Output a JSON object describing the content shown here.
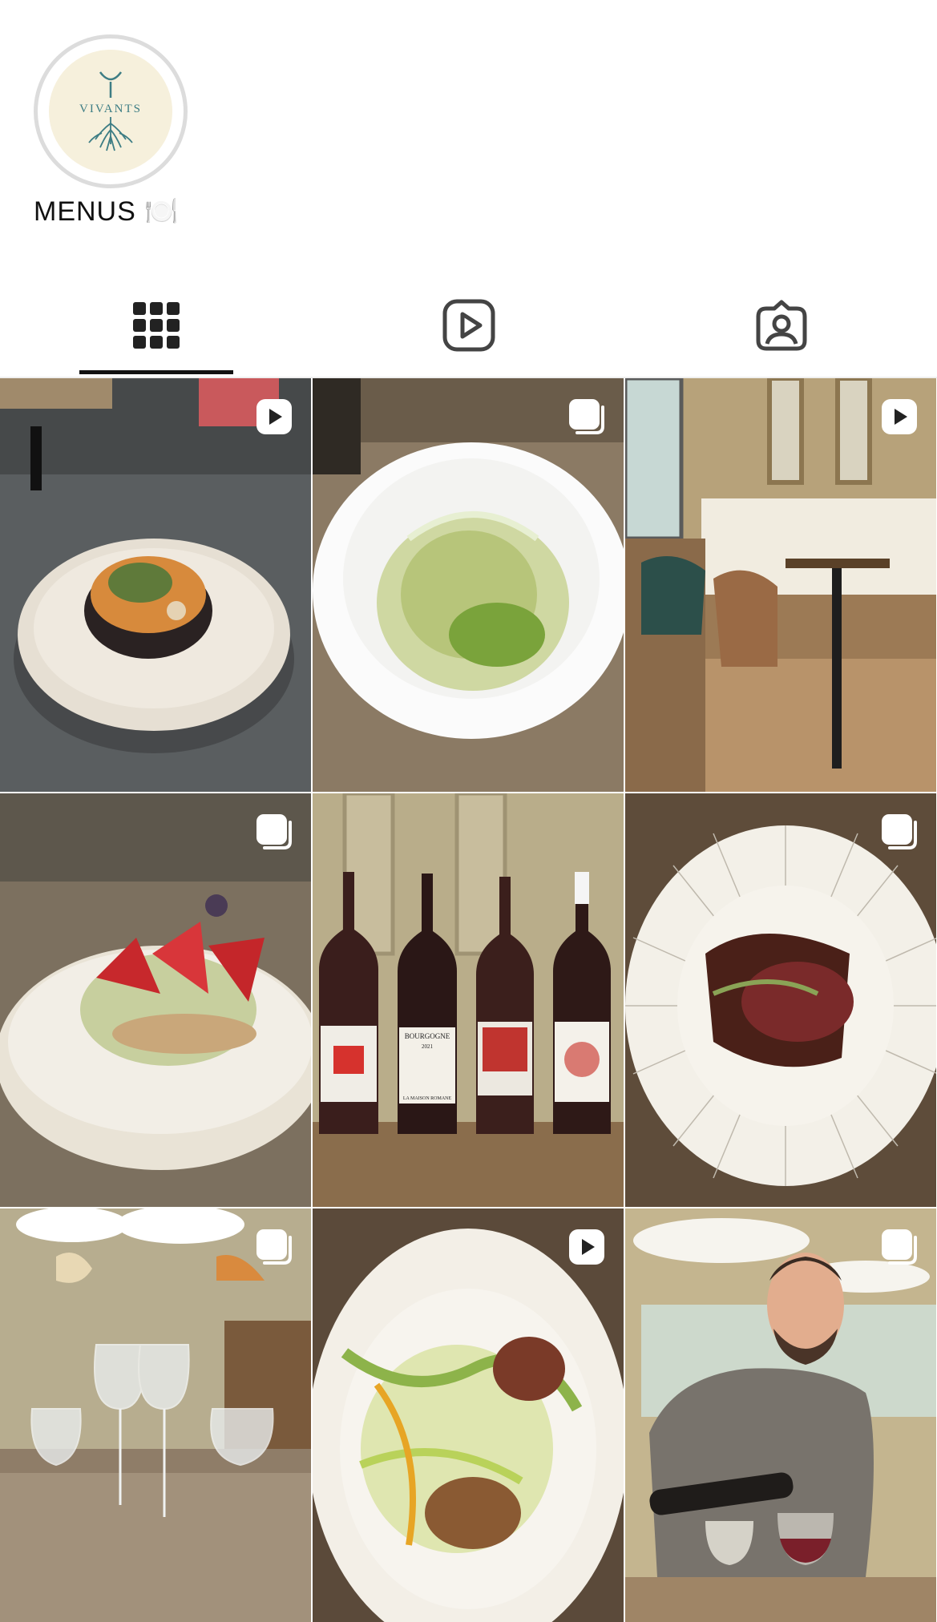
{
  "highlight": {
    "label": "MENUS 🍽️",
    "logo_text": "VIVANTS",
    "logo_color": "#3d7d84",
    "background": "#f6f0dc"
  },
  "tabs": [
    {
      "name": "posts",
      "icon": "grid-icon",
      "active": true
    },
    {
      "name": "reels",
      "icon": "reels-play-icon",
      "active": false
    },
    {
      "name": "tagged",
      "icon": "tagged-person-icon",
      "active": false
    }
  ],
  "posts": [
    {
      "type": "video",
      "subject": "plated dish on dark counter"
    },
    {
      "type": "carousel",
      "subject": "pasta in white bowl"
    },
    {
      "type": "video",
      "subject": "restaurant dining room"
    },
    {
      "type": "carousel",
      "subject": "strawberry dessert"
    },
    {
      "type": "carousel",
      "subject": "four wine bottles"
    },
    {
      "type": "carousel",
      "subject": "meat on striped plate"
    },
    {
      "type": "carousel",
      "subject": "wine glasses on table"
    },
    {
      "type": "video",
      "subject": "plated dish with greens"
    },
    {
      "type": "carousel",
      "subject": "server pouring wine"
    }
  ],
  "wine_labels": [
    "BOURGOGNE",
    "2021",
    "LA MAISON ROMANE"
  ]
}
